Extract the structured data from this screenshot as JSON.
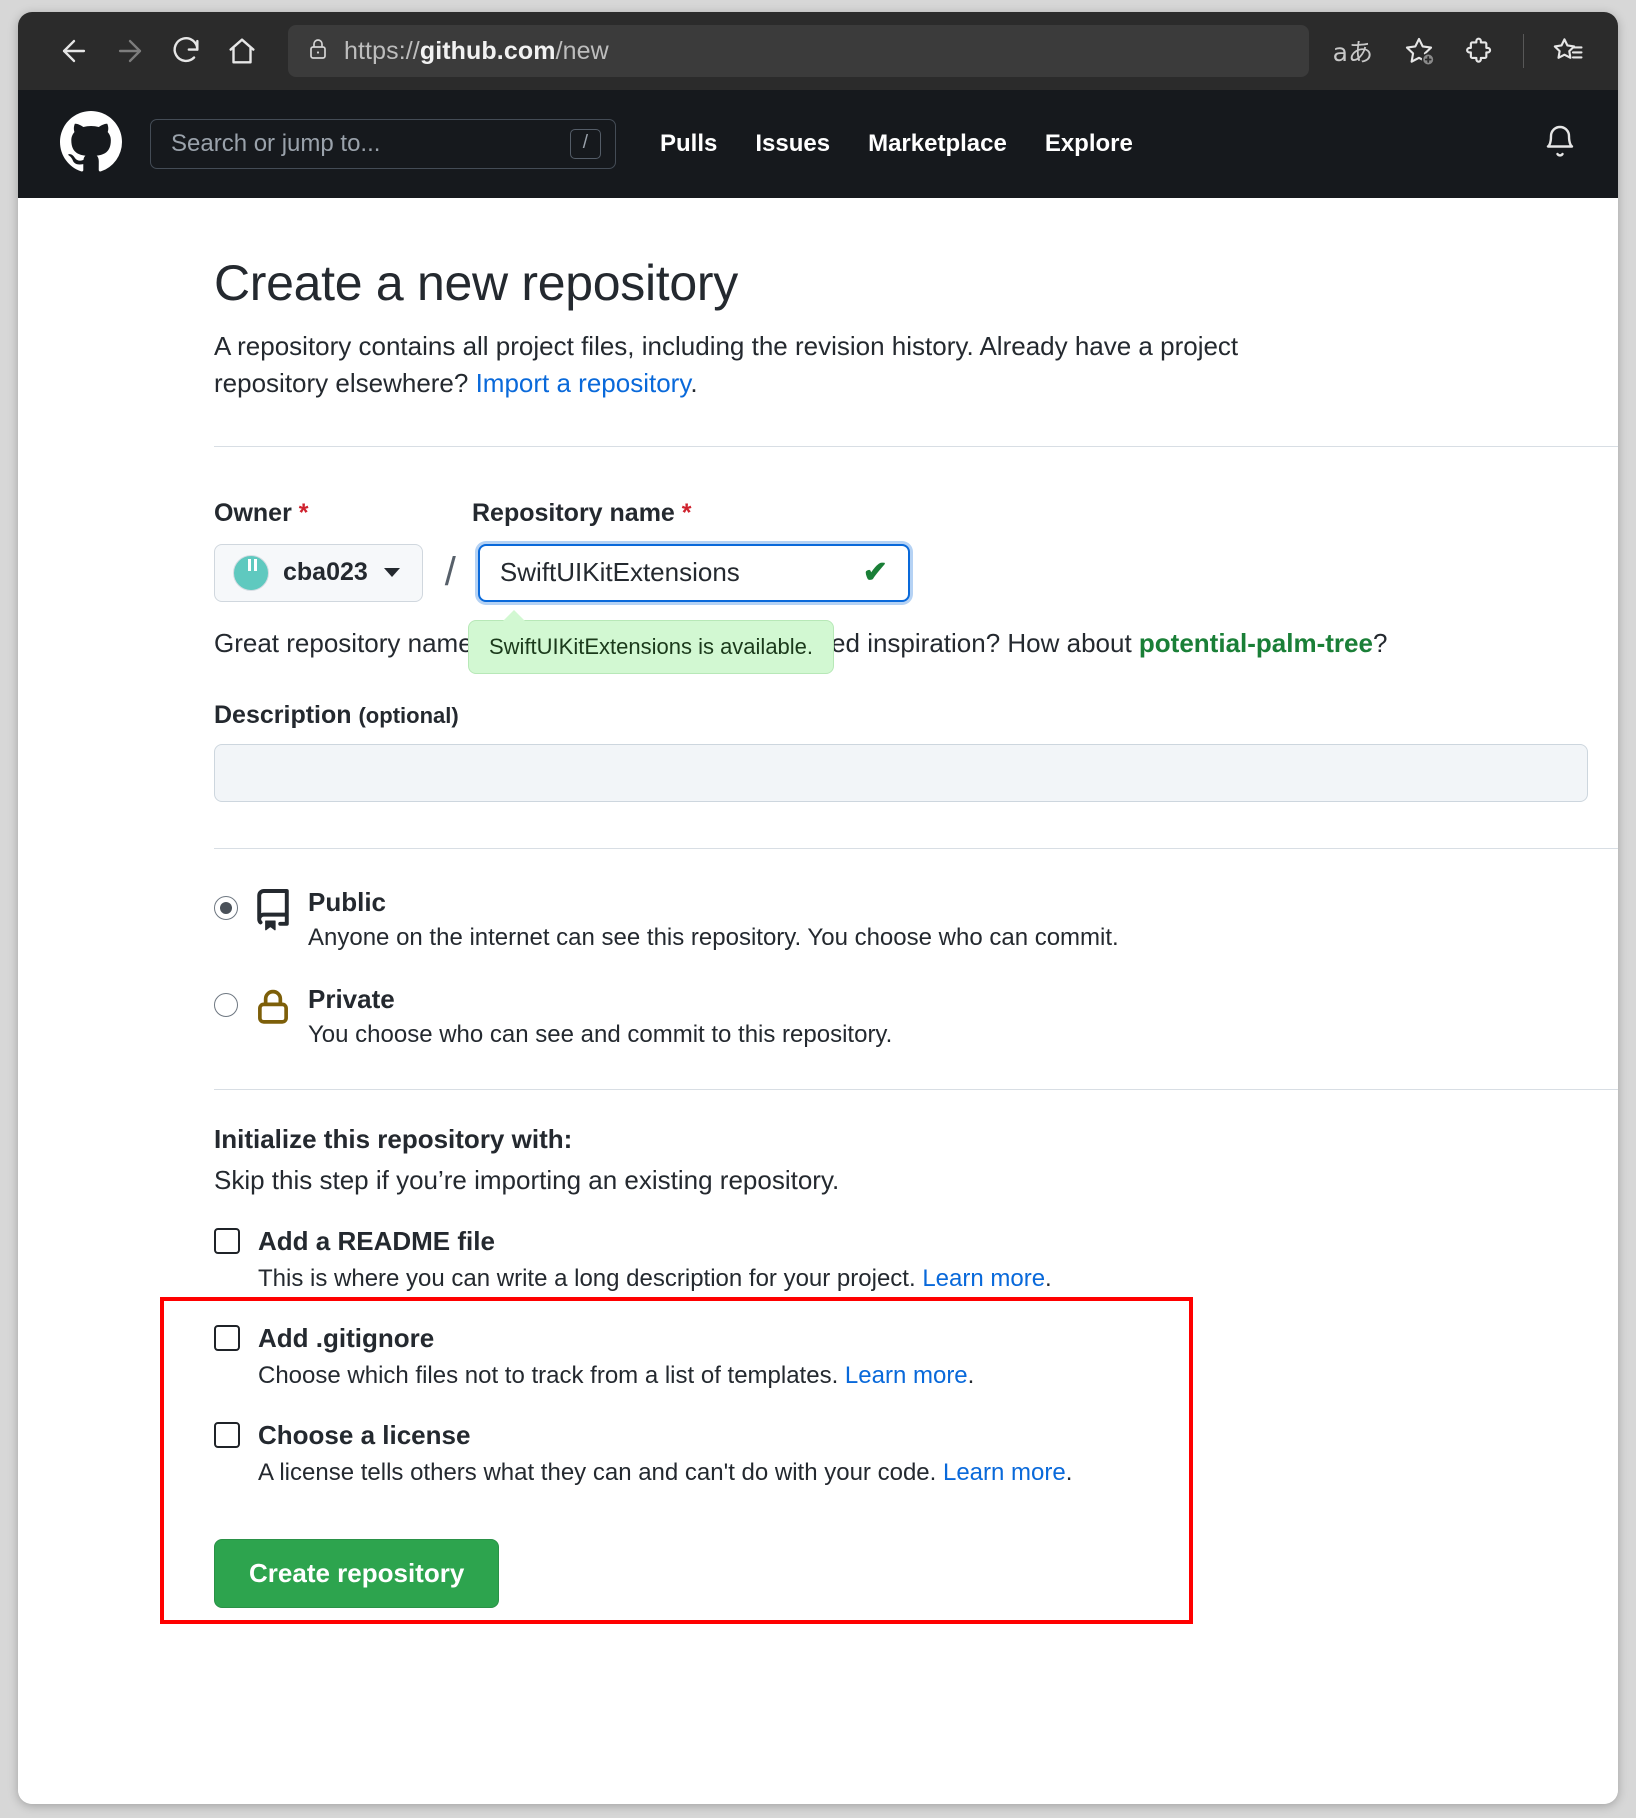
{
  "browser": {
    "back_icon": "arrow-left-icon",
    "forward_icon": "arrow-right-icon",
    "reload_icon": "reload-icon",
    "home_icon": "home-icon",
    "lock_icon": "lock-icon",
    "url_prefix": "https://",
    "url_host": "github.com",
    "url_path": "/new",
    "translate_icon_label": "aあ",
    "add_favorite_icon": "star-plus-icon",
    "extensions_icon": "puzzle-piece-icon",
    "collections_icon": "star-list-icon"
  },
  "gh_header": {
    "logo": "github-octocat-logo",
    "search_placeholder": "Search or jump to...",
    "search_shortcut": "/",
    "nav": [
      {
        "label": "Pulls"
      },
      {
        "label": "Issues"
      },
      {
        "label": "Marketplace"
      },
      {
        "label": "Explore"
      }
    ],
    "bell_icon": "bell-icon"
  },
  "page": {
    "title": "Create a new repository",
    "subtitle_part1": "A repository contains all project files, including the revision history. Already have a project repository elsewhere? ",
    "subtitle_link": "Import a repository",
    "subtitle_part2": "."
  },
  "form": {
    "owner_label": "Owner",
    "owner_required": "*",
    "owner_value": "cba023",
    "separator": "/",
    "repo_label": "Repository name",
    "repo_required": "*",
    "repo_value": "SwiftUIKitExtensions",
    "repo_available_check": "✔",
    "availability_tooltip": "SwiftUIKitExtensions is available.",
    "hint_prefix": "Great repository names are short and memorable. Need inspiration? How about ",
    "hint_suggestion": "potential-palm-tree",
    "hint_suffix": "?",
    "description_label": "Description",
    "description_optional": "(optional)",
    "description_value": "",
    "description_placeholder": ""
  },
  "visibility": {
    "options": [
      {
        "title": "Public",
        "description": "Anyone on the internet can see this repository. You choose who can commit.",
        "icon": "repo-book-icon",
        "selected": true
      },
      {
        "title": "Private",
        "description": "You choose who can see and commit to this repository.",
        "icon": "lock-icon",
        "selected": false
      }
    ]
  },
  "initialize": {
    "heading": "Initialize this repository with:",
    "subheading": "Skip this step if you’re importing an existing repository.",
    "highlight_color": "#ff0000",
    "options": [
      {
        "label": "Add a README file",
        "description": "This is where you can write a long description for your project. ",
        "learn_more": "Learn more",
        "description_end": ".",
        "checked": false
      },
      {
        "label": "Add .gitignore",
        "description": "Choose which files not to track from a list of templates. ",
        "learn_more": "Learn more",
        "description_end": ".",
        "checked": false
      },
      {
        "label": "Choose a license",
        "description": "A license tells others what they can and can't do with your code. ",
        "learn_more": "Learn more",
        "description_end": ".",
        "checked": false
      }
    ]
  },
  "actions": {
    "create_label": "Create repository"
  }
}
